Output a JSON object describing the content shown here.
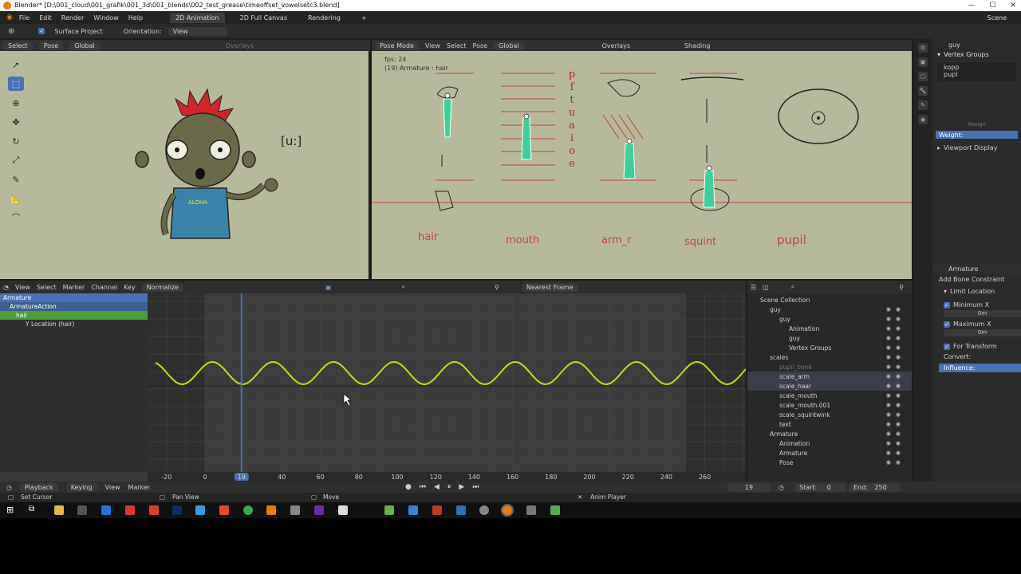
{
  "window": {
    "title": "Blender* [D:\\001_cloud\\001_grafik\\001_3d\\001_blends\\002_test_grease\\timeoffset_vowelsetc3.blend]",
    "controls": [
      "—",
      "☐",
      "✕"
    ]
  },
  "menu": {
    "items": [
      "File",
      "Edit",
      "Render",
      "Window",
      "Help"
    ],
    "workspaces": [
      "2D Animation",
      "2D Full Canvas",
      "Rendering"
    ],
    "active_workspace": "2D Animation",
    "add_tab": "+",
    "scene": "Scene"
  },
  "toolsettings": {
    "surface_project": "Surface Project",
    "orientation_label": "Orientation:",
    "orientation_value": "View"
  },
  "left_viewport": {
    "header": [
      "Select",
      "Pose",
      "Global",
      "Overlays"
    ],
    "drawing_text": "[u:]",
    "shirt_text": "ALOHA"
  },
  "right_viewport": {
    "header": [
      "Pose Mode",
      "View",
      "Select",
      "Pose",
      "Global",
      "Overlays",
      "Shading"
    ],
    "fps": "fps: 24",
    "armature_info": "(19) Armature : hair",
    "mouth_letters": [
      "p",
      "f",
      "t",
      "u",
      "a",
      "i",
      "o",
      "e"
    ],
    "labels": [
      "hair",
      "mouth",
      "arm_r",
      "squint",
      "pupil"
    ]
  },
  "graph_editor": {
    "header": [
      "View",
      "Select",
      "Marker",
      "Channel",
      "Key"
    ],
    "normalize": "Normalize",
    "snap": "Nearest Frame",
    "channels": [
      {
        "label": "Armature",
        "type": "object"
      },
      {
        "label": "ArmatureAction",
        "type": "action"
      },
      {
        "label": "hair",
        "type": "group"
      },
      {
        "label": "Y Location (hair)",
        "type": "fcurve"
      }
    ],
    "frame_ticks": [
      "-20",
      "0",
      "19",
      "40",
      "60",
      "80",
      "100",
      "120",
      "140",
      "160",
      "180",
      "200",
      "220",
      "240",
      "260"
    ],
    "current_frame": "19",
    "curve_color": "#b5e21c"
  },
  "outliner": {
    "items": [
      {
        "label": "Scene Collection",
        "depth": 0
      },
      {
        "label": "guy",
        "depth": 1
      },
      {
        "label": "guy",
        "depth": 2
      },
      {
        "label": "Animation",
        "depth": 3
      },
      {
        "label": "guy",
        "depth": 3
      },
      {
        "label": "Vertex Groups",
        "depth": 3
      },
      {
        "label": "scales",
        "depth": 1
      },
      {
        "label": "pupil_bone",
        "depth": 2
      },
      {
        "label": "scale_arm",
        "depth": 2
      },
      {
        "label": "scale_haar",
        "depth": 2
      },
      {
        "label": "scale_mouth",
        "depth": 2
      },
      {
        "label": "scale_mouth.001",
        "depth": 2
      },
      {
        "label": "scale_squintwink",
        "depth": 2
      },
      {
        "label": "text",
        "depth": 2
      },
      {
        "label": "Armature",
        "depth": 1
      },
      {
        "label": "Animation",
        "depth": 2
      },
      {
        "label": "Armature",
        "depth": 2
      },
      {
        "label": "Pose",
        "depth": 2
      }
    ]
  },
  "properties_top": {
    "object": "guy",
    "panel": "Vertex Groups",
    "groups": [
      "kopp",
      "pupl"
    ],
    "assign": "Assign",
    "weight": "Weight:",
    "viewport_display": "Viewport Display"
  },
  "properties_bottom": {
    "object": "Armature",
    "add_constraint": "Add Bone Constraint",
    "constraint": "Limit Location",
    "minimum_x": "Minimum X",
    "min_value": "0m",
    "maximum_x": "Maximum X",
    "max_value": "0m",
    "for_transform": "For Transform",
    "convert": "Convert:",
    "influence": "Influence:"
  },
  "timeline": {
    "items": [
      "Playback",
      "Keying",
      "View",
      "Marker"
    ],
    "frame": "19",
    "start_label": "Start:",
    "start": "0",
    "end_label": "End:",
    "end": "250"
  },
  "statusbar": {
    "set_cursor": "Set Cursor",
    "pan_view": "Pan View",
    "move": "Move",
    "anim_player": "Anim Player"
  }
}
